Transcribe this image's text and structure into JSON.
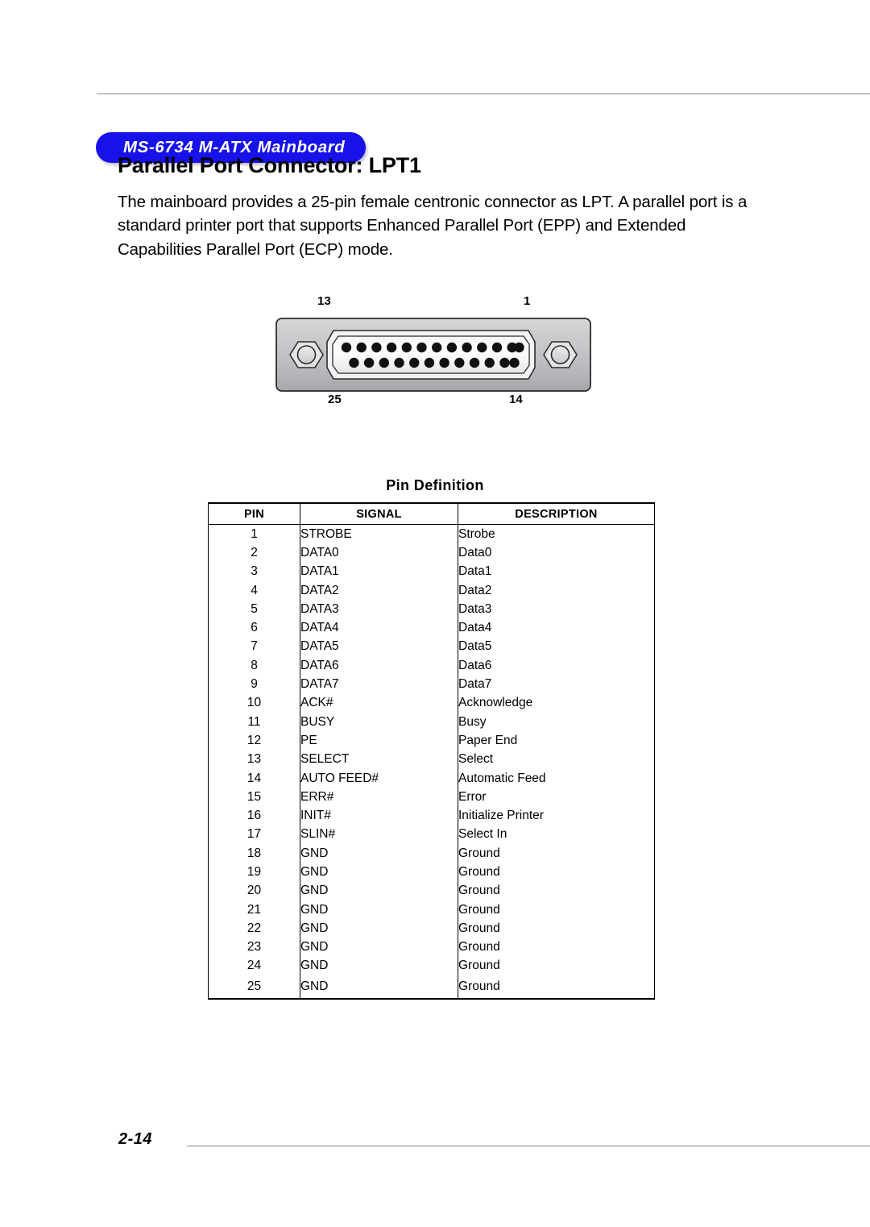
{
  "header": {
    "banner_text": "MS-6734 M-ATX Mainboard",
    "banner_color": "#1712e8",
    "banner_text_color": "#ffffff"
  },
  "section": {
    "title": "Parallel Port Connector: LPT1",
    "paragraph": "The mainboard provides a 25-pin female centronic connector as LPT.  A parallel port is a standard printer port that supports Enhanced Parallel Port (EPP) and Extended Capabilities Parallel Port (ECP) mode."
  },
  "connector_figure": {
    "name": "db25-female-connector",
    "top_left_label": "13",
    "top_right_label": "1",
    "bottom_left_label": "25",
    "bottom_right_label": "14",
    "top_row_pin_count": 13,
    "bottom_row_pin_count": 12,
    "total_pins": 25,
    "shell_color": "#c3c4c6",
    "pin_color": "#000000",
    "insert_color": "#ffffff"
  },
  "table": {
    "caption": "Pin Definition",
    "columns": [
      "PIN",
      "SIGNAL",
      "DESCRIPTION"
    ],
    "rows": [
      {
        "pin": "1",
        "signal": "STROBE",
        "description": "Strobe"
      },
      {
        "pin": "2",
        "signal": "DATA0",
        "description": "Data0"
      },
      {
        "pin": "3",
        "signal": "DATA1",
        "description": "Data1"
      },
      {
        "pin": "4",
        "signal": "DATA2",
        "description": "Data2"
      },
      {
        "pin": "5",
        "signal": "DATA3",
        "description": "Data3"
      },
      {
        "pin": "6",
        "signal": "DATA4",
        "description": "Data4"
      },
      {
        "pin": "7",
        "signal": "DATA5",
        "description": "Data5"
      },
      {
        "pin": "8",
        "signal": "DATA6",
        "description": "Data6"
      },
      {
        "pin": "9",
        "signal": "DATA7",
        "description": "Data7"
      },
      {
        "pin": "10",
        "signal": "ACK#",
        "description": "Acknowledge"
      },
      {
        "pin": "11",
        "signal": "BUSY",
        "description": "Busy"
      },
      {
        "pin": "12",
        "signal": "PE",
        "description": "Paper End"
      },
      {
        "pin": "13",
        "signal": "SELECT",
        "description": "Select"
      },
      {
        "pin": "14",
        "signal": "AUTO FEED#",
        "description": "Automatic Feed"
      },
      {
        "pin": "15",
        "signal": "ERR#",
        "description": "Error"
      },
      {
        "pin": "16",
        "signal": "INIT#",
        "description": "Initialize Printer"
      },
      {
        "pin": "17",
        "signal": "SLIN#",
        "description": "Select In"
      },
      {
        "pin": "18",
        "signal": "GND",
        "description": "Ground"
      },
      {
        "pin": "19",
        "signal": "GND",
        "description": "Ground"
      },
      {
        "pin": "20",
        "signal": "GND",
        "description": "Ground"
      },
      {
        "pin": "21",
        "signal": "GND",
        "description": "Ground"
      },
      {
        "pin": "22",
        "signal": "GND",
        "description": "Ground"
      },
      {
        "pin": "23",
        "signal": "GND",
        "description": "Ground"
      },
      {
        "pin": "24",
        "signal": "GND",
        "description": "Ground"
      },
      {
        "pin": "25",
        "signal": "GND",
        "description": "Ground"
      }
    ]
  },
  "footer": {
    "page_number": "2-14"
  }
}
